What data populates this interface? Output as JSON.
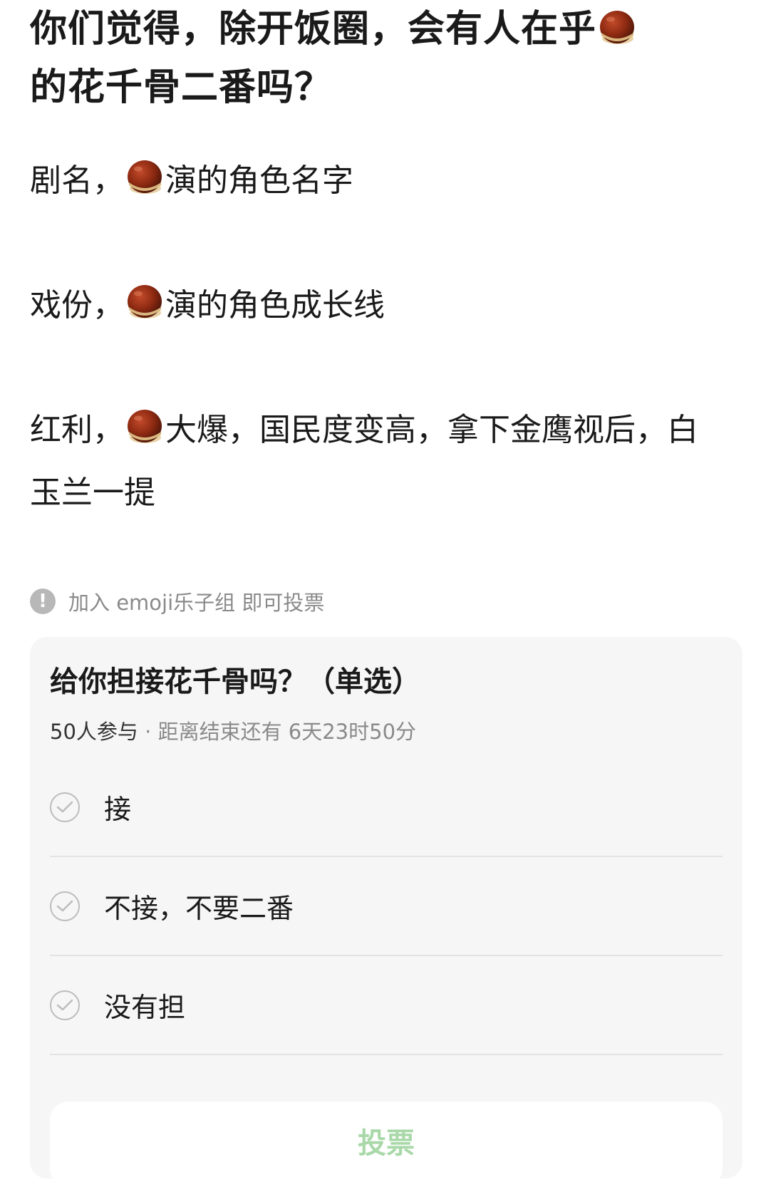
{
  "post": {
    "title_part1": "你们觉得，除开饭圈，会有人在乎",
    "title_part2": "的花千骨二番吗？",
    "paragraphs": [
      {
        "prefix": "剧名，",
        "suffix": "演的角色名字"
      },
      {
        "prefix": "戏份，",
        "suffix": "演的角色成长线"
      },
      {
        "prefix": "红利，",
        "suffix": "大爆，国民度变高，拿下金鹰视后，白玉兰一提"
      }
    ],
    "emoji_icon": "chestnut-icon"
  },
  "notice": {
    "icon": "exclamation-icon",
    "text": "加入 emoji乐子组 即可投票"
  },
  "poll": {
    "title": "给你担接花千骨吗？（单选）",
    "participants": "50人参与",
    "separator": " · ",
    "remaining": "距离结束还有 6天23时50分",
    "options": [
      {
        "label": "接"
      },
      {
        "label": "不接，不要二番"
      },
      {
        "label": "没有担"
      }
    ],
    "vote_label": "投票"
  },
  "colors": {
    "vote_text": "#a9d8a9",
    "card_bg": "#f6f6f6",
    "muted_text": "#8a8a8a"
  }
}
